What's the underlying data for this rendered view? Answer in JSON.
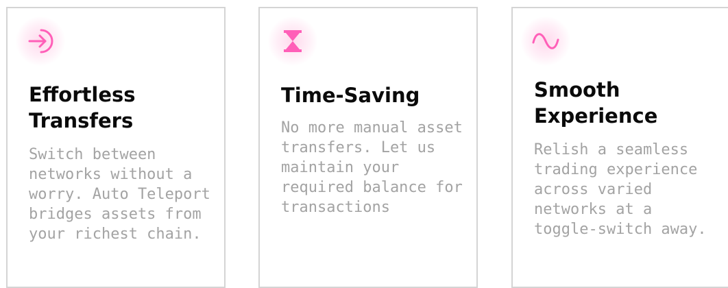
{
  "cards": [
    {
      "title": "Effortless Transfers",
      "description": "Switch between networks without a worry. Auto Teleport bridges assets from your richest chain.",
      "icon": "arrow-into-bracket-icon"
    },
    {
      "title": "Time-Saving",
      "description": "No more manual asset transfers. Let us maintain your required balance for transactions",
      "icon": "hourglass-icon"
    },
    {
      "title": "Smooth Experience",
      "description": "Relish a seamless trading experience across varied networks at a toggle-switch away.",
      "icon": "sine-wave-icon"
    }
  ],
  "colors": {
    "accent": "#ff5fb8",
    "title": "#0a0a0a",
    "description": "#a3a3a3",
    "border": "#d4d4d4"
  }
}
